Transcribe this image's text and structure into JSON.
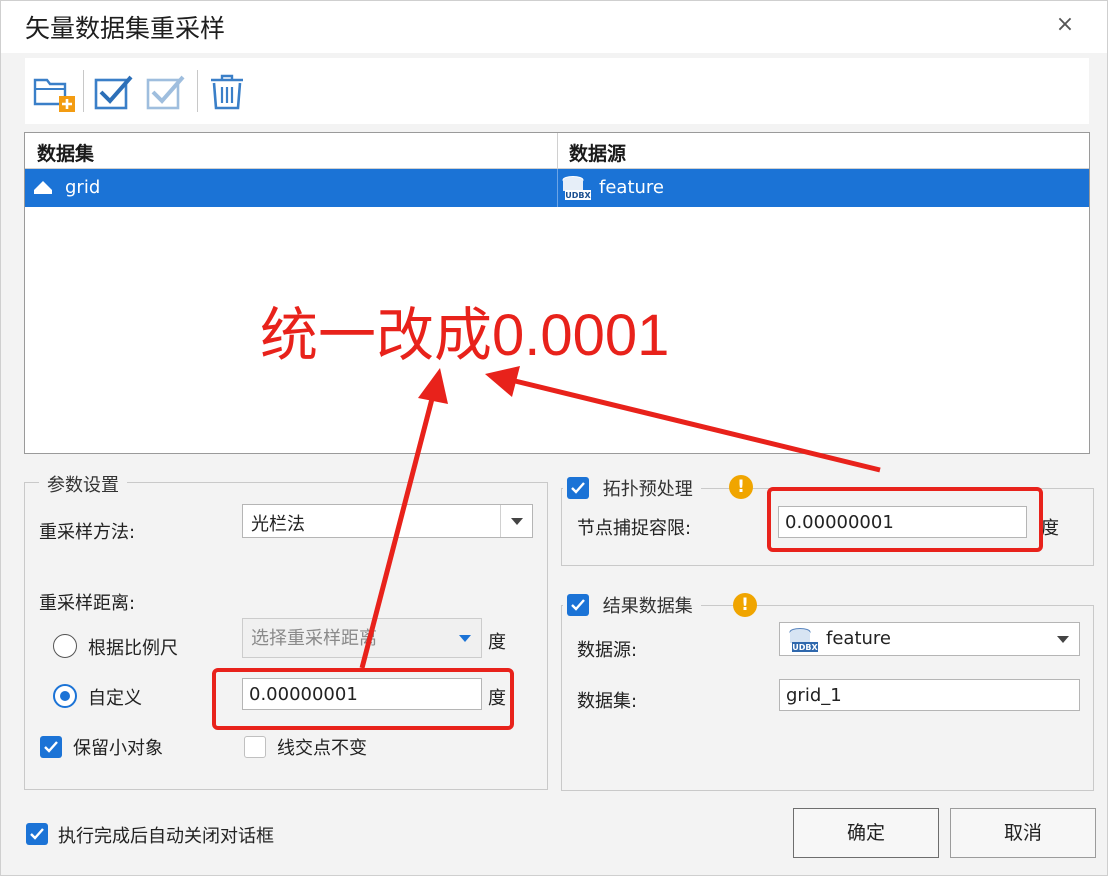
{
  "window": {
    "title": "矢量数据集重采样",
    "close_glyph": "×"
  },
  "toolbar": {
    "buttons": [
      {
        "icon": "add-folder-icon"
      },
      {
        "icon": "select-all-icon"
      },
      {
        "icon": "select-inverse-icon"
      },
      {
        "icon": "delete-icon"
      }
    ]
  },
  "grid": {
    "columns": [
      "数据集",
      "数据源"
    ],
    "rows": [
      {
        "dataset": "grid",
        "datasource": "feature",
        "dataset_icon": "region-dataset-icon",
        "datasource_icon": "udbx-datasource-icon"
      }
    ]
  },
  "annotation": {
    "text": "统一改成0.0001",
    "color": "#e8221b"
  },
  "params": {
    "legend": "参数设置",
    "method_label": "重采样方法:",
    "method_value": "光栏法",
    "distance_label": "重采样距离:",
    "by_scale_label": "根据比例尺",
    "scale_placeholder": "选择重采样距离",
    "unit_degree": "度",
    "custom_label": "自定义",
    "custom_value": "0.00000001",
    "custom_unit": "度",
    "keep_small_label": "保留小对象",
    "keep_small_checked": true,
    "keep_intersections_label": "线交点不变",
    "keep_intersections_checked": false,
    "selected_mode": "custom"
  },
  "topology": {
    "legend": "拓扑预处理",
    "enabled": true,
    "tolerance_label": "节点捕捉容限:",
    "tolerance_value": "0.00000001",
    "tolerance_unit": "度",
    "warn_glyph": "!"
  },
  "result": {
    "legend": "结果数据集",
    "enabled": true,
    "datasource_label": "数据源:",
    "datasource_value": "feature",
    "dataset_label": "数据集:",
    "dataset_value": "grid_1",
    "warn_glyph": "!"
  },
  "footer": {
    "auto_close_label": "执行完成后自动关闭对话框",
    "auto_close_checked": true,
    "ok_label": "确定",
    "cancel_label": "取消"
  },
  "colors": {
    "accent": "#1b73d6",
    "annotation": "#e8221b",
    "warning": "#f0a500"
  }
}
